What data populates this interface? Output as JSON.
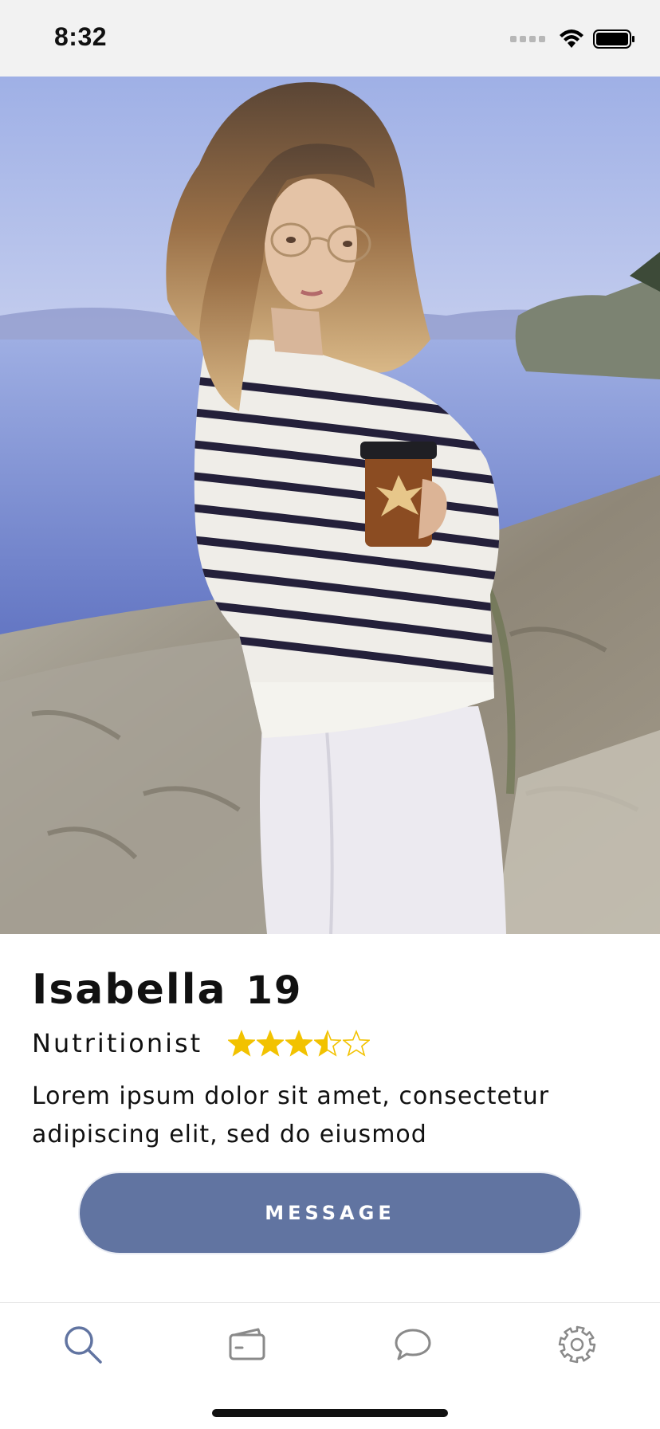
{
  "status_bar": {
    "time": "8:32"
  },
  "profile": {
    "name": "Isabella",
    "age": "19",
    "role": "Nutritionist",
    "rating": 3.5,
    "rating_max": 5,
    "description": "Lorem ipsum dolor sit amet, consectetur adipiscing elit, sed do eiusmod"
  },
  "actions": {
    "message_label": "MESSAGE"
  },
  "tab_bar": {
    "items": [
      {
        "icon": "search-icon",
        "active": true
      },
      {
        "icon": "wallet-icon",
        "active": false
      },
      {
        "icon": "chat-bubble-icon",
        "active": false
      },
      {
        "icon": "gear-icon",
        "active": false
      }
    ]
  },
  "colors": {
    "accent": "#6174a1",
    "star": "#f2c200",
    "icon_inactive": "#8a8a8a"
  }
}
